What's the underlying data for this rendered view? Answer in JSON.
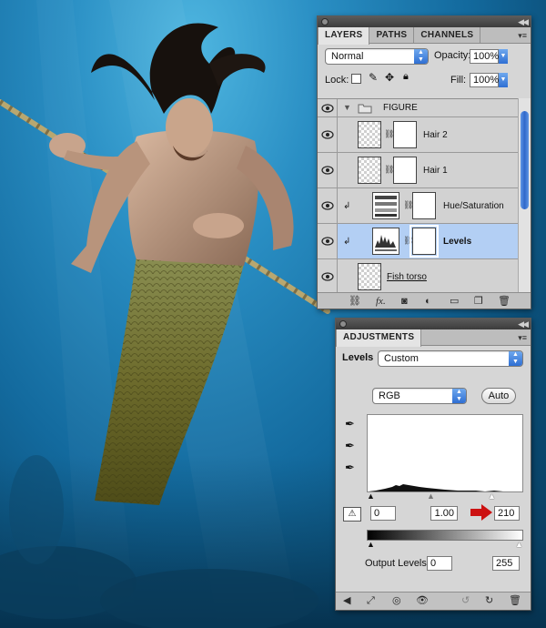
{
  "layers_panel": {
    "tabs": [
      "LAYERS",
      "PATHS",
      "CHANNELS"
    ],
    "blend_mode": "Normal",
    "opacity_label": "Opacity:",
    "opacity_value": "100%",
    "lock_label": "Lock:",
    "fill_label": "Fill:",
    "fill_value": "100%",
    "layers": [
      {
        "name": "FIGURE",
        "type": "group"
      },
      {
        "name": "Hair 2",
        "type": "pixel-with-mask"
      },
      {
        "name": "Hair 1",
        "type": "pixel-with-mask"
      },
      {
        "name": "Hue/Saturation",
        "type": "adjustment"
      },
      {
        "name": "Levels",
        "type": "adjustment",
        "selected": true
      },
      {
        "name": "Fish torso",
        "type": "pixel"
      }
    ],
    "bottom_icons": [
      "link-icon",
      "fx-icon",
      "add-mask-icon",
      "adjustment-layer-icon",
      "new-group-icon",
      "new-layer-icon",
      "trash-icon"
    ],
    "fx_text": "fx."
  },
  "adjustments_panel": {
    "tab": "ADJUSTMENTS",
    "type_label": "Levels",
    "preset": "Custom",
    "channel": "RGB",
    "auto_label": "Auto",
    "input_black": "0",
    "input_gamma": "1.00",
    "input_white": "210",
    "output_label": "Output Levels:",
    "output_black": "0",
    "output_white": "255",
    "accent_arrow_color": "#cc1111"
  }
}
